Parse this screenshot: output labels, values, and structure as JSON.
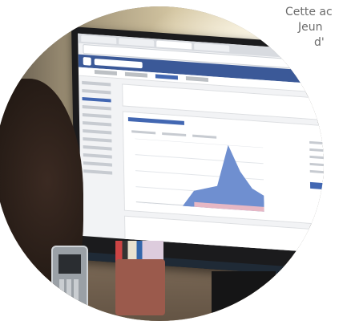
{
  "caption_lines": [
    "Cette ac",
    "Jeun",
    "d'"
  ],
  "photo": {
    "subject": "Person viewing a Facebook page insights chart on a desktop monitor",
    "colors": {
      "facebook_blue": "#3b5998",
      "accent_blue": "#4267b2",
      "chart_fill": "#6f8fd0",
      "chart_pink": "#e6b7c4"
    },
    "screen_chart_values": [
      0,
      0,
      0,
      0,
      0,
      0.25,
      0.3,
      0.35,
      1.0,
      0.6,
      0.35,
      0.25
    ]
  }
}
